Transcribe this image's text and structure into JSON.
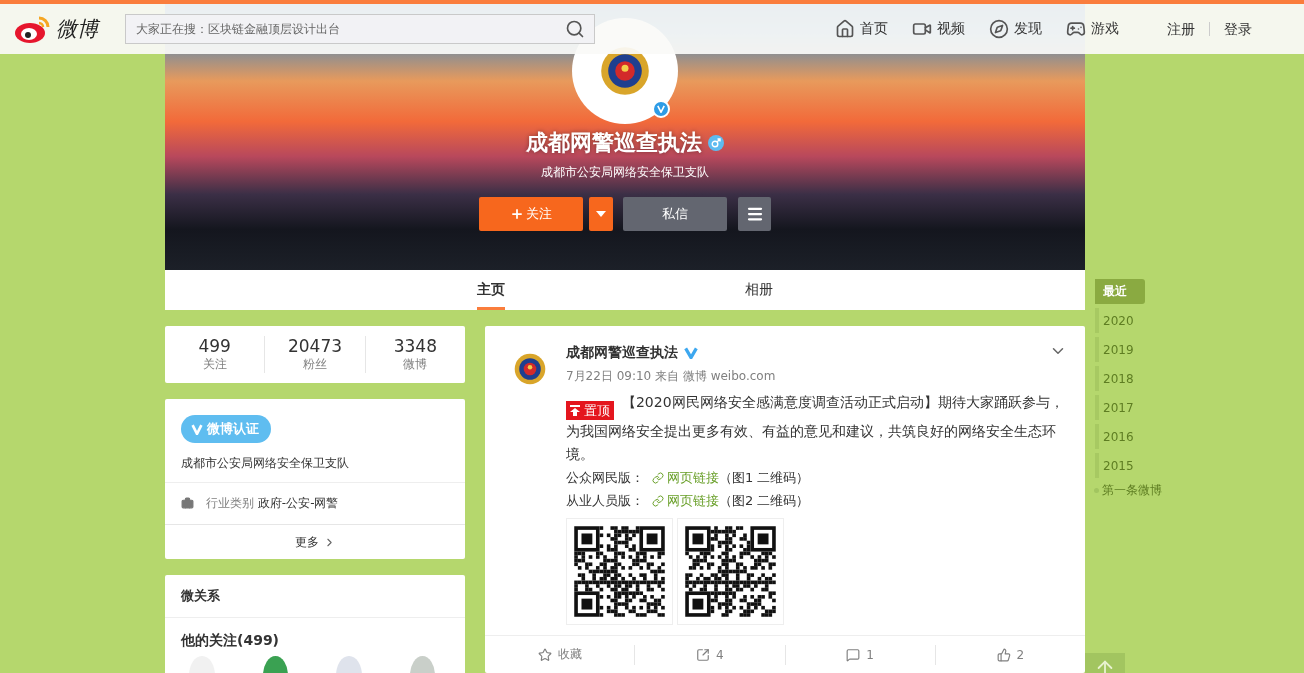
{
  "header": {
    "logo_text": "微博",
    "search": {
      "placeholder": "大家正在搜：区块链金融顶层设计出台"
    },
    "nav": [
      {
        "kind": "home",
        "label": "首页"
      },
      {
        "kind": "video",
        "label": "视频"
      },
      {
        "kind": "discover",
        "label": "发现"
      },
      {
        "kind": "game",
        "label": "游戏"
      }
    ],
    "auth": [
      "注册",
      "登录"
    ]
  },
  "profile": {
    "name": "成都网警巡查执法",
    "verified": true,
    "description": "成都市公安局网络安全保卫支队",
    "follow_label": "关注",
    "message_label": "私信"
  },
  "tabs": [
    {
      "label": "主页",
      "selected": true
    },
    {
      "label": "相册",
      "selected": false
    }
  ],
  "stats": [
    {
      "value": "499",
      "label": "关注"
    },
    {
      "value": "20473",
      "label": "粉丝"
    },
    {
      "value": "3348",
      "label": "微博"
    }
  ],
  "verification": {
    "badge": "微博认证",
    "text": "成都市公安局网络安全保卫支队",
    "industry_label": "行业类别",
    "industry_value": "政府-公安-网警",
    "more": "更多"
  },
  "relations": {
    "title": "微关系",
    "following": "他的关注(499)"
  },
  "post": {
    "author": "成都网警巡查执法",
    "verified": true,
    "meta": "7月22日 09:10 来自 微博 weibo.com",
    "pinned": "置顶",
    "body": "【2020网民网络安全感满意度调查活动正式启动】期待大家踊跃参与，为我国网络安全提出更多有效、有益的意见和建议，共筑良好的网络安全生态环境。",
    "links": [
      {
        "label": "公众网民版：",
        "link": "网页链接",
        "note": "（图1 二维码）"
      },
      {
        "label": "从业人员版：",
        "link": "网页链接",
        "note": "（图2 二维码）"
      }
    ],
    "actions": [
      {
        "kind": "favorite",
        "label": "收藏"
      },
      {
        "kind": "repost",
        "label": "4"
      },
      {
        "kind": "comment",
        "label": "1"
      },
      {
        "kind": "like",
        "label": "2"
      }
    ]
  },
  "timeline": {
    "items": [
      {
        "label": "最近",
        "selected": true
      },
      {
        "label": "2020",
        "selected": false
      },
      {
        "label": "2019",
        "selected": false
      },
      {
        "label": "2018",
        "selected": false
      },
      {
        "label": "2017",
        "selected": false
      },
      {
        "label": "2016",
        "selected": false
      },
      {
        "label": "2015",
        "selected": false
      }
    ],
    "first": "第一条微博"
  }
}
